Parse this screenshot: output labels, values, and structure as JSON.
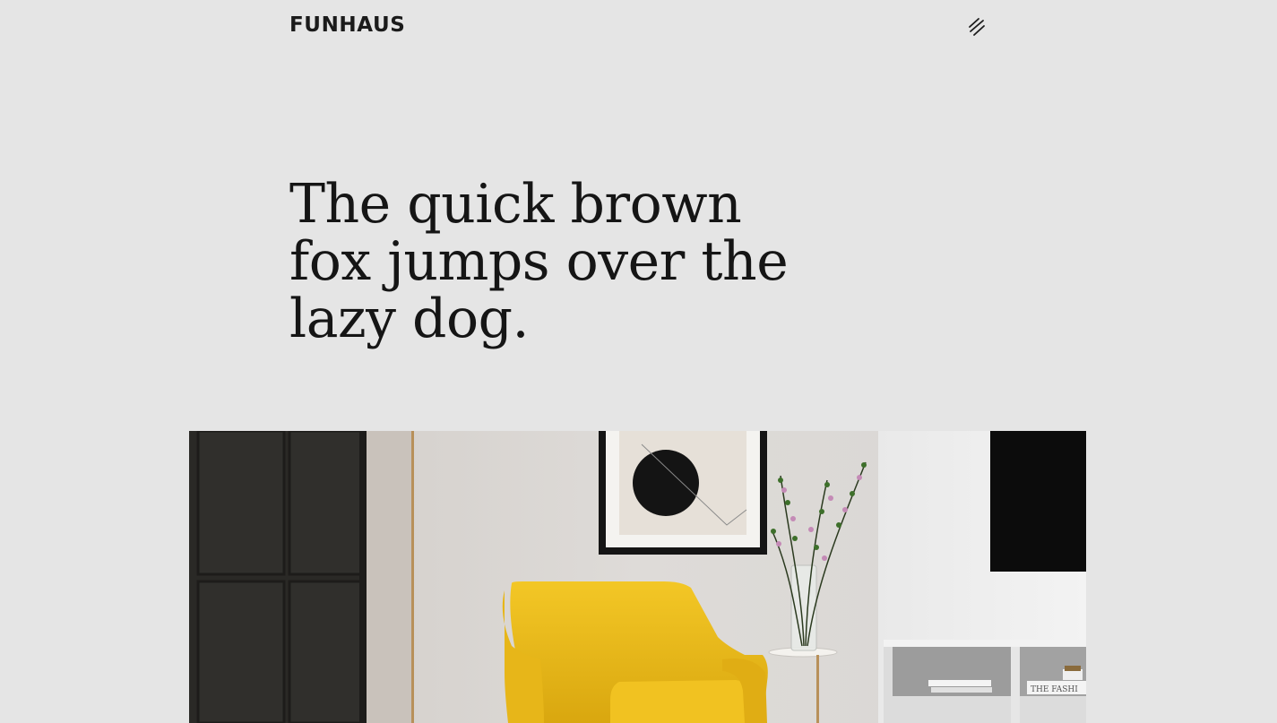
{
  "header": {
    "logo": "FUNHAUS",
    "menu_icon": "menu-lines-icon"
  },
  "hero": {
    "title": "The quick brown fox jumps over the lazy dog.",
    "image": {
      "name": "interior-photo",
      "book_spine_text": "THE FASHI"
    }
  },
  "colors": {
    "background": "#e5e5e5",
    "text": "#151515",
    "armchair": "#f0c21e"
  }
}
